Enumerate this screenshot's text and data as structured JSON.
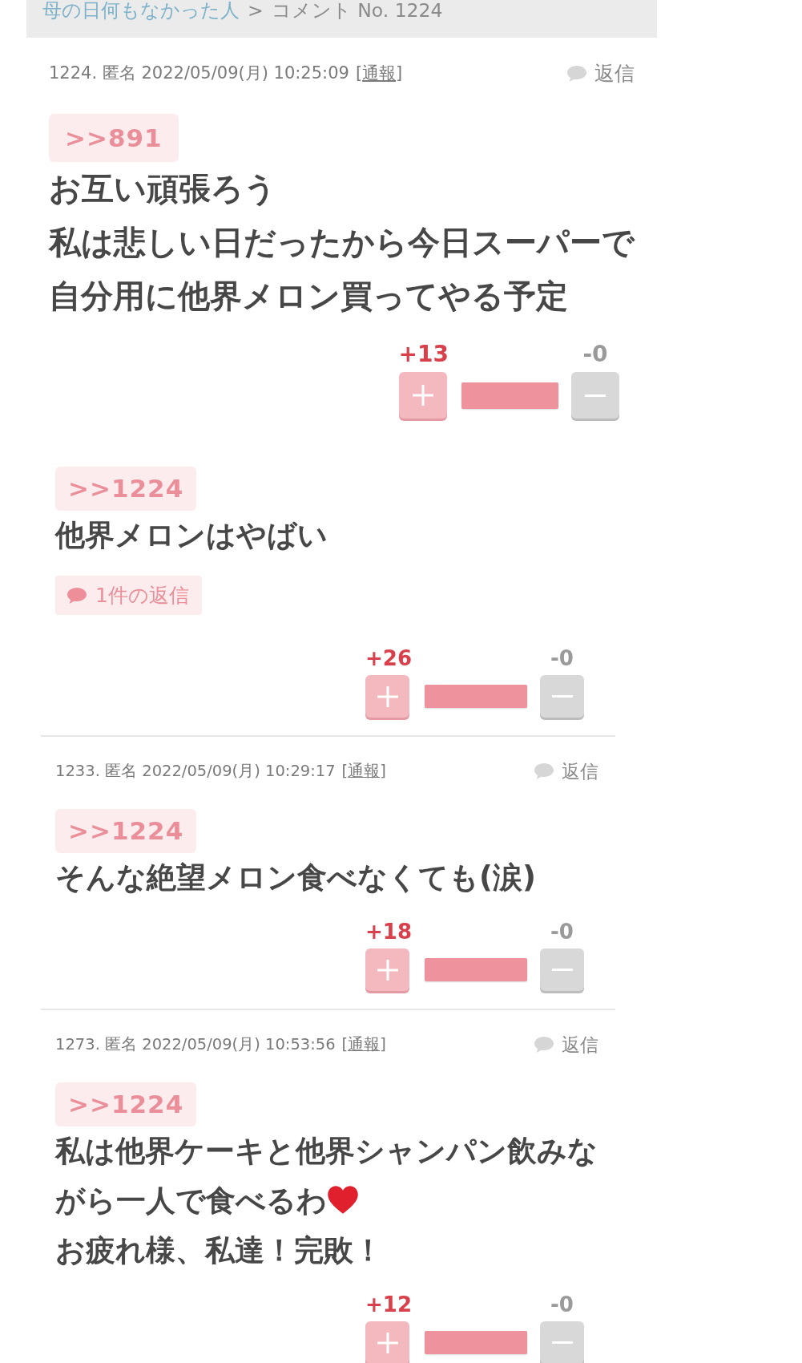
{
  "breadcrumb": {
    "parent": "母の日何もなかった人",
    "separator": ">",
    "current": "コメント No. 1224"
  },
  "comments": [
    {
      "kind": "main",
      "meta": "1224. 匿名 2022/05/09(月) 10:25:09",
      "report": "[通報]",
      "reply": "返信",
      "anchor": ">>891",
      "body": [
        {
          "text": "お互い頑張ろう"
        },
        {
          "text": "私は悲しい日だったから今日スーパーで自分用に他界メロン買ってやる予定"
        }
      ],
      "votes": {
        "plus": "+13",
        "minus": "-0",
        "level": 1
      }
    },
    {
      "kind": "reply",
      "anchor": ">>1224",
      "body": [
        {
          "text": "他界メロンはやばい"
        }
      ],
      "replies": "1件の返信",
      "votes": {
        "plus": "+26",
        "minus": "-0",
        "level": 1
      }
    },
    {
      "kind": "reply",
      "meta": "1233. 匿名 2022/05/09(月) 10:29:17",
      "report": "[通報]",
      "reply": "返信",
      "anchor": ">>1224",
      "body": [
        {
          "text": "そんな絶望メロン食べなくても(涙)"
        }
      ],
      "votes": {
        "plus": "+18",
        "minus": "-0",
        "level": 1
      }
    },
    {
      "kind": "reply",
      "meta": "1273. 匿名 2022/05/09(月) 10:53:56",
      "report": "[通報]",
      "reply": "返信",
      "anchor": ">>1224",
      "body": [
        {
          "text": "私は他界ケーキと他界シャンパン飲みな",
          "emoji": false
        },
        {
          "text": "がら一人で食べるわ",
          "emoji": true
        },
        {
          "text": "お疲れ様、私達！完敗！",
          "emoji": false
        }
      ],
      "votes": {
        "plus": "+12",
        "minus": "-0",
        "level": 1
      }
    }
  ]
}
